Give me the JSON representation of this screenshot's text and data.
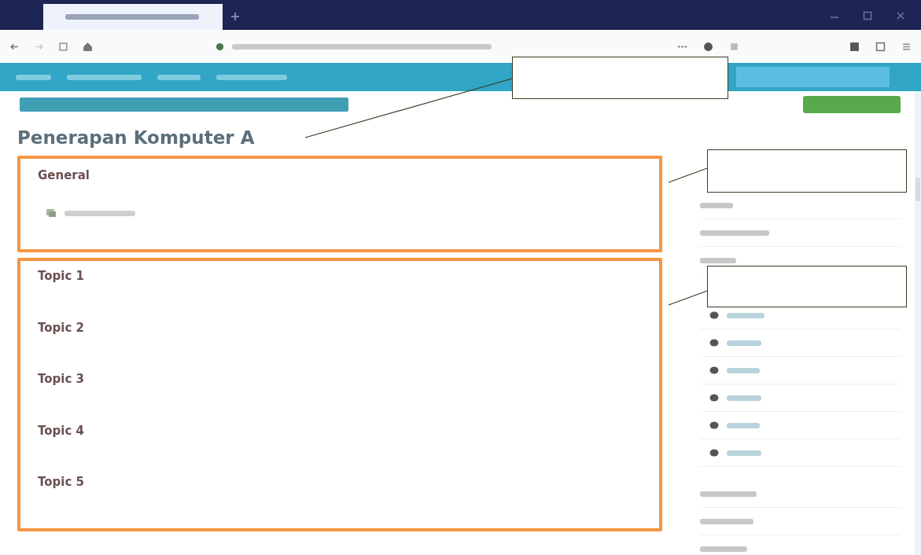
{
  "browser": {
    "tabs": [
      {
        "selected": true
      }
    ]
  },
  "course": {
    "title": "Penerapan Komputer A"
  },
  "sections": [
    {
      "title": "General",
      "items": [
        {
          "kind": "forum"
        }
      ]
    },
    {
      "title": "Topic 1"
    },
    {
      "title": "Topic 2"
    },
    {
      "title": "Topic 3"
    },
    {
      "title": "Topic 4"
    },
    {
      "title": "Topic 5"
    }
  ],
  "sidebar": {
    "items": [
      {
        "kind": "heading"
      },
      {
        "kind": "heading"
      },
      {
        "kind": "heading"
      },
      {
        "kind": "topic"
      },
      {
        "kind": "topic"
      },
      {
        "kind": "topic"
      },
      {
        "kind": "topic"
      },
      {
        "kind": "topic"
      },
      {
        "kind": "topic"
      },
      {
        "kind": "heading"
      },
      {
        "kind": "heading"
      },
      {
        "kind": "heading"
      }
    ]
  },
  "callouts": [
    {
      "kind": "box"
    },
    {
      "kind": "box"
    },
    {
      "kind": "box"
    }
  ]
}
